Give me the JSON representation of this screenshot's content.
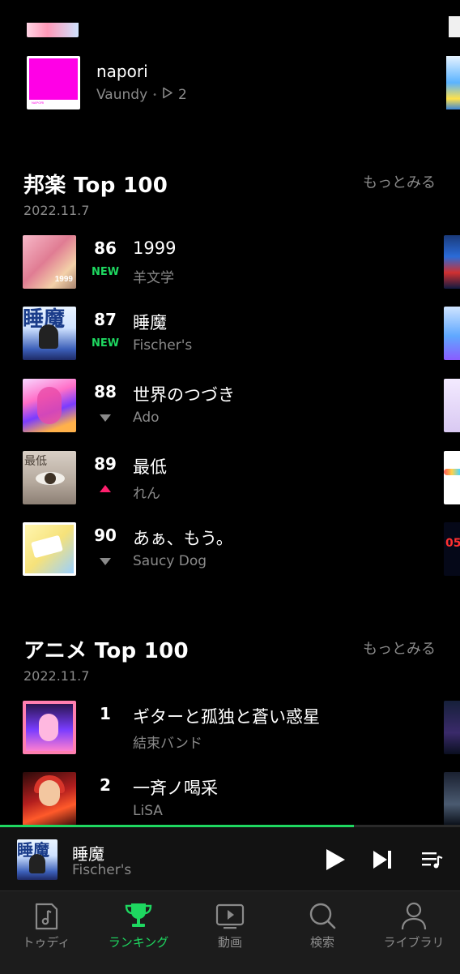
{
  "top_partial": {},
  "napori": {
    "title": "napori",
    "artist": "Vaundy",
    "play_count": "2",
    "art_text": "NAPORI"
  },
  "sections": [
    {
      "title": "邦楽 Top 100",
      "more": "もっとみる",
      "date": "2022.11.7",
      "items": [
        {
          "rank": "86",
          "status": "NEW",
          "title": "1999",
          "artist": "羊文学",
          "art_text": "1999"
        },
        {
          "rank": "87",
          "status": "NEW",
          "title": "睡魔",
          "artist": "Fischer's",
          "art_text": "睡魔"
        },
        {
          "rank": "88",
          "status": "down",
          "title": "世界のつづき",
          "artist": "Ado"
        },
        {
          "rank": "89",
          "status": "up",
          "title": "最低",
          "artist": "れん",
          "art_text": "最低"
        },
        {
          "rank": "90",
          "status": "down",
          "title": "あぁ、もう。",
          "artist": "Saucy Dog"
        }
      ]
    },
    {
      "title": "アニメ Top 100",
      "more": "もっとみる",
      "date": "2022.11.7",
      "items": [
        {
          "rank": "1",
          "status": "",
          "title": "ギターと孤独と蒼い惑星",
          "artist": "結束バンド"
        },
        {
          "rank": "2",
          "status": "",
          "title": "一斉ノ喝采",
          "artist": "LiSA"
        }
      ]
    }
  ],
  "now_playing": {
    "title": "睡魔",
    "artist": "Fischer's",
    "progress": 0.77,
    "art_text": "睡魔"
  },
  "tabs": [
    {
      "label": "トゥディ",
      "icon": "music-note-icon",
      "active": false
    },
    {
      "label": "ランキング",
      "icon": "trophy-icon",
      "active": true
    },
    {
      "label": "動画",
      "icon": "video-icon",
      "active": false
    },
    {
      "label": "検索",
      "icon": "search-icon",
      "active": false
    },
    {
      "label": "ライブラリ",
      "icon": "person-icon",
      "active": false
    }
  ],
  "colors": {
    "accent": "#1ed760",
    "rank_up": "#ff1f6d",
    "secondary_text": "#8a8a8a",
    "background": "#000000"
  }
}
